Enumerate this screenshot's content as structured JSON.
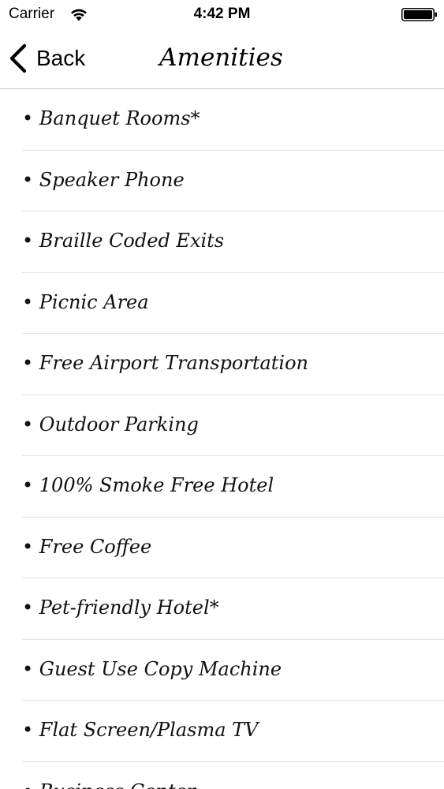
{
  "status_bar": {
    "carrier": "Carrier",
    "time": "4:42 PM",
    "wifi_icon": "wifi-icon",
    "battery_icon": "battery-icon"
  },
  "nav": {
    "back_label": "Back",
    "back_icon": "chevron-left-icon",
    "title": "Amenities"
  },
  "amenities": [
    "• Banquet Rooms*",
    "• Speaker Phone",
    "• Braille Coded Exits",
    "• Picnic Area",
    "• Free Airport Transportation",
    "• Outdoor Parking",
    "• 100% Smoke Free Hotel",
    "• Free Coffee",
    "• Pet-friendly Hotel*",
    "• Guest Use Copy Machine",
    "• Flat Screen/Plasma TV",
    "• Business Center"
  ],
  "colors": {
    "text": "#000000",
    "separator": "#e3e3e6",
    "background": "#ffffff"
  }
}
